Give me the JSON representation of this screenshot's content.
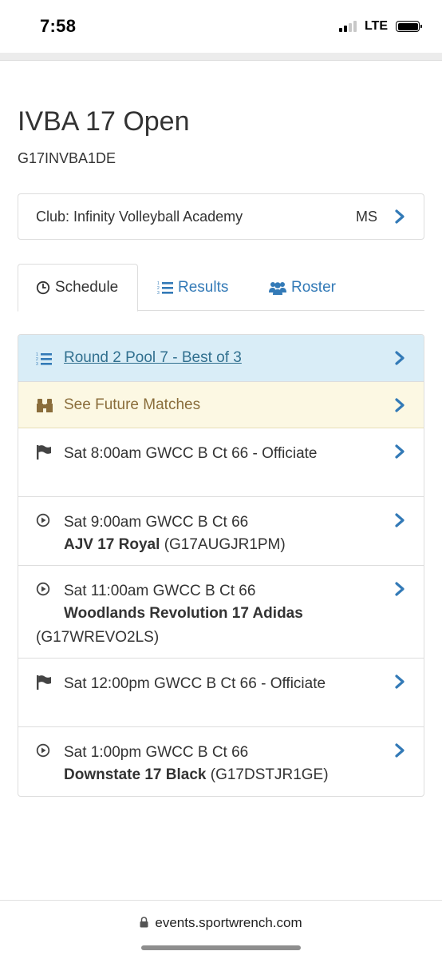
{
  "status_bar": {
    "time": "7:58",
    "network": "LTE"
  },
  "team": {
    "title": "IVBA 17 Open",
    "code": "G17INVBA1DE"
  },
  "club": {
    "label": "Club: Infinity Volleyball Academy",
    "state": "MS"
  },
  "tabs": [
    {
      "label": "Schedule",
      "icon": "clock-icon",
      "active": true
    },
    {
      "label": "Results",
      "icon": "list-ol-icon",
      "active": false
    },
    {
      "label": "Roster",
      "icon": "users-icon",
      "active": false
    }
  ],
  "schedule": {
    "pool_link": "Round 2 Pool 7 - Best of 3",
    "future_label": "See Future Matches",
    "matches": [
      {
        "icon": "flag-icon",
        "line1": "Sat 8:00am GWCC B Ct 66 - Officiate"
      },
      {
        "icon": "play-circle-icon",
        "line1": "Sat 9:00am GWCC B Ct 66",
        "opponent": "AJV 17 Royal",
        "opponent_code": "(G17AUGJR1PM)"
      },
      {
        "icon": "play-circle-icon",
        "line1": "Sat 11:00am GWCC B Ct 66",
        "opponent": "Woodlands Revolution 17 Adidas",
        "opponent_code": "(G17WREVO2LS)"
      },
      {
        "icon": "flag-icon",
        "line1": "Sat 12:00pm GWCC B Ct 66 - Officiate"
      },
      {
        "icon": "play-circle-icon",
        "line1": "Sat 1:00pm GWCC B Ct 66",
        "opponent": "Downstate 17 Black",
        "opponent_code": "(G17DSTJR1GE)"
      }
    ]
  },
  "browser": {
    "url": "events.sportwrench.com"
  },
  "colors": {
    "link": "#337ab7",
    "info_bg": "#d9edf7",
    "warning_bg": "#fcf8e3",
    "warning_text": "#8a6d3b",
    "info_text": "#31708f"
  }
}
